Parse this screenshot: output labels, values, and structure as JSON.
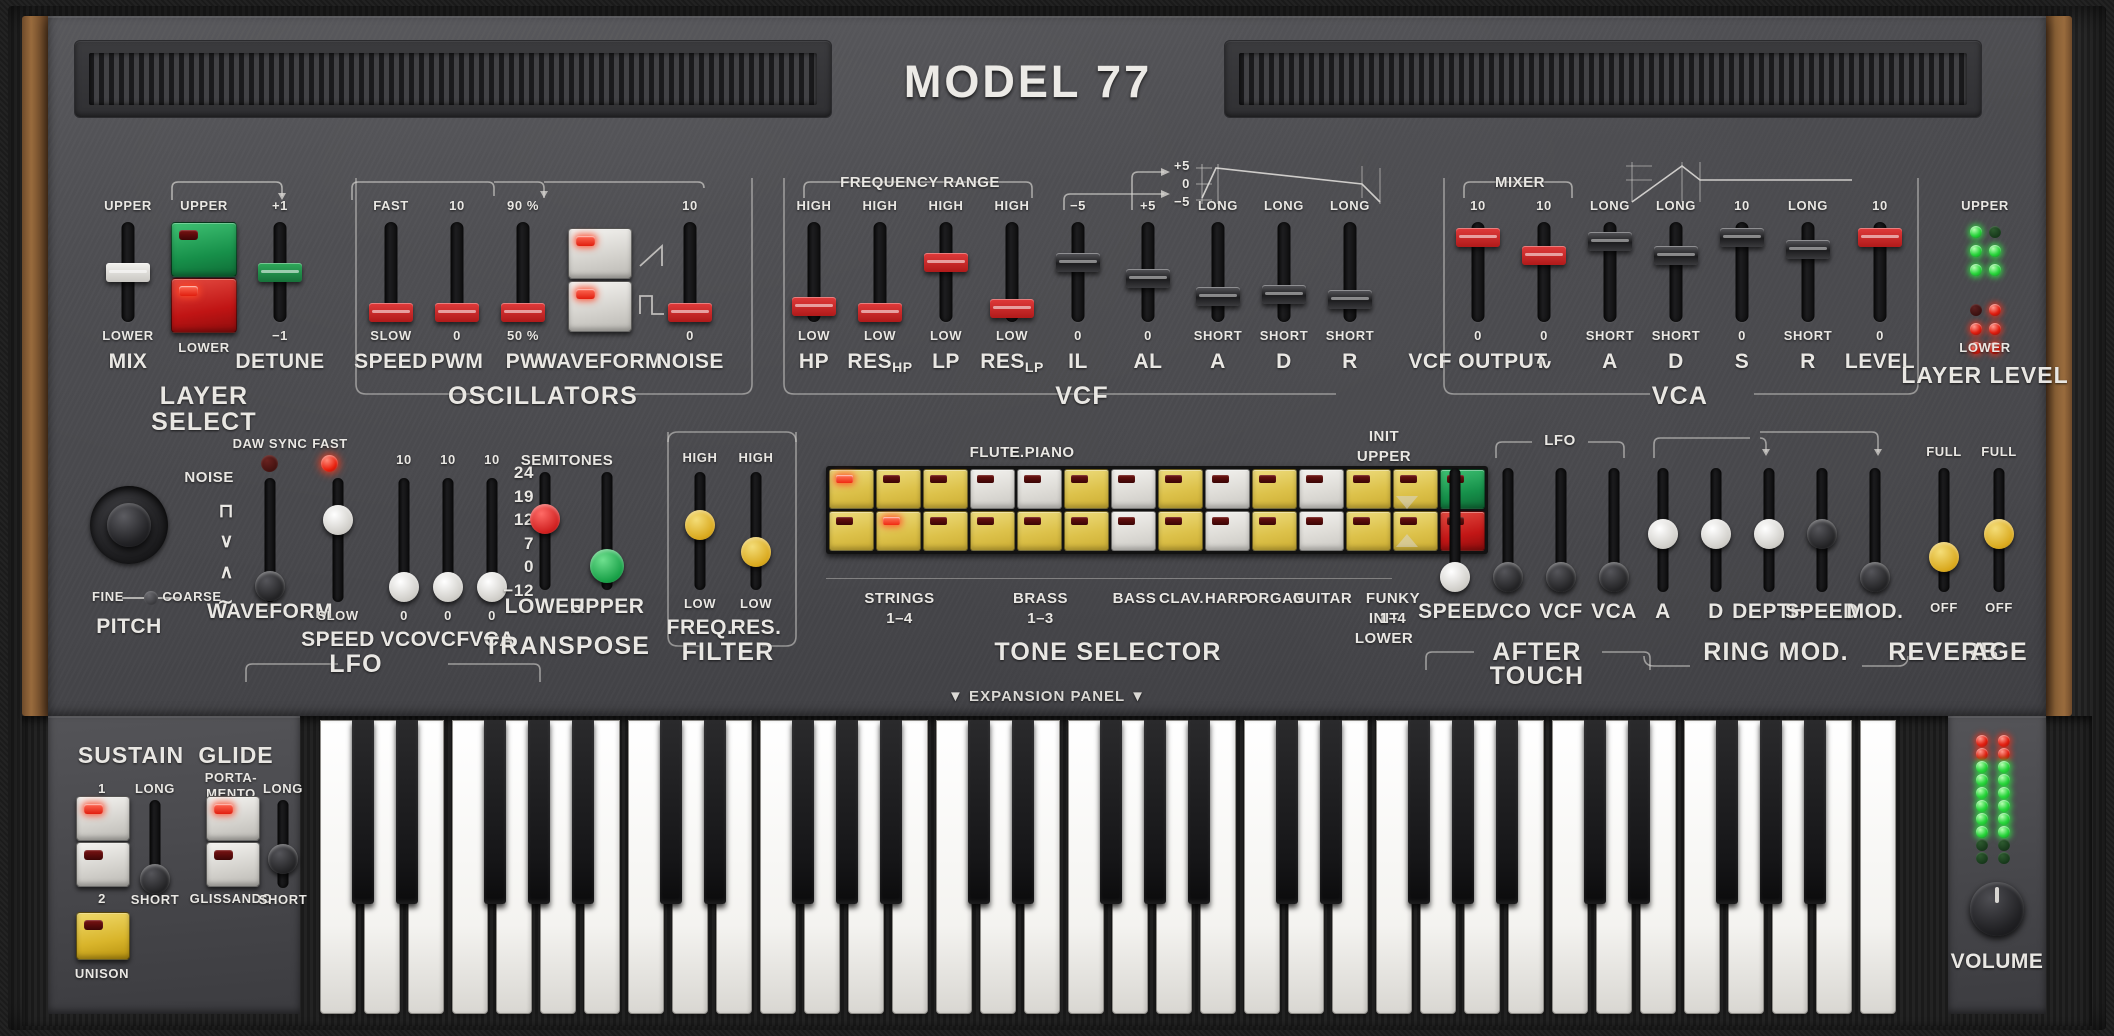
{
  "brand": {
    "title": "MODEL 77"
  },
  "expansion_strip": {
    "label": "▼ EXPANSION PANEL ▼"
  },
  "layer_select": {
    "section": "LAYER SELECT",
    "mix": {
      "param": "MIX",
      "top": "UPPER",
      "bottom": "LOWER"
    },
    "buttons": {
      "upper": "UPPER",
      "lower": "LOWER"
    },
    "detune": {
      "param": "DETUNE",
      "top": "+1",
      "bottom": "−1"
    }
  },
  "oscillators": {
    "section": "OSCILLATORS",
    "speed": {
      "param": "SPEED",
      "top": "FAST",
      "bottom": "SLOW"
    },
    "pwm": {
      "param": "PWM",
      "top": "10",
      "bottom": "0"
    },
    "pw": {
      "param": "PW",
      "top": "90 %",
      "bottom": "50 %"
    },
    "waveform": {
      "param": "WAVEFORM"
    },
    "noise": {
      "param": "NOISE",
      "top": "10",
      "bottom": "0"
    }
  },
  "vcf": {
    "section": "VCF",
    "frequency_range": "FREQUENCY RANGE",
    "hp": {
      "param": "HP",
      "top": "HIGH",
      "bottom": "LOW"
    },
    "reshp": {
      "param": "RES",
      "sub": "HP",
      "top": "HIGH",
      "bottom": "LOW"
    },
    "lp": {
      "param": "LP",
      "top": "HIGH",
      "bottom": "LOW"
    },
    "reslp": {
      "param": "RES",
      "sub": "LP",
      "top": "HIGH",
      "bottom": "LOW"
    },
    "il": {
      "param": "IL",
      "top": "−5",
      "bottom": "0"
    },
    "al": {
      "param": "AL",
      "top": "+5",
      "bottom": "0"
    },
    "a": {
      "param": "A",
      "top": "LONG",
      "bottom": "SHORT"
    },
    "d": {
      "param": "D",
      "top": "LONG",
      "bottom": "SHORT"
    },
    "r": {
      "param": "R",
      "top": "LONG",
      "bottom": "SHORT"
    },
    "env_graph": {
      "plus": "+5",
      "zero": "0",
      "minus": "−5"
    }
  },
  "vca": {
    "section": "VCA",
    "mixer": "MIXER",
    "vcf_output": {
      "param": "VCF OUTPUT",
      "top": "10",
      "bottom": "0"
    },
    "sine": {
      "param": "∿",
      "top": "10",
      "bottom": "0"
    },
    "a": {
      "param": "A",
      "top": "LONG",
      "bottom": "SHORT"
    },
    "d": {
      "param": "D",
      "top": "LONG",
      "bottom": "SHORT"
    },
    "s": {
      "param": "S",
      "top": "10",
      "bottom": "0"
    },
    "r": {
      "param": "R",
      "top": "LONG",
      "bottom": "SHORT"
    },
    "level": {
      "param": "LEVEL",
      "top": "10",
      "bottom": "0"
    }
  },
  "layer_level": {
    "section": "LAYER LEVEL",
    "top": "UPPER",
    "bottom": "LOWER",
    "upper_leds": [
      [
        1,
        0
      ],
      [
        1,
        1
      ],
      [
        1,
        1
      ]
    ],
    "lower_leds": [
      [
        0,
        1
      ],
      [
        1,
        1
      ],
      [
        1,
        1
      ]
    ]
  },
  "pitch": {
    "section": "PITCH",
    "fine": "FINE",
    "coarse": "COARSE"
  },
  "lfo": {
    "section": "LFO",
    "daw_sync": {
      "label": "DAW SYNC",
      "on": false
    },
    "fast_led": {
      "label": "FAST",
      "on": true
    },
    "waveform": {
      "param": "WAVEFORM",
      "scale": [
        "NOISE",
        "⊓",
        "∨",
        "∧",
        "∼"
      ]
    },
    "speed": {
      "param": "SPEED",
      "bottom": "SLOW"
    },
    "vco": {
      "param": "VCO",
      "top": "10",
      "bottom": "0"
    },
    "vcf": {
      "param": "VCF",
      "top": "10",
      "bottom": "0"
    },
    "vca": {
      "param": "VCA",
      "top": "10",
      "bottom": "0"
    }
  },
  "transpose": {
    "section": "TRANSPOSE",
    "semitones": "SEMITONES",
    "scale": [
      "24",
      "19",
      "12",
      "7",
      "0",
      "−12"
    ],
    "lower": "LOWER",
    "upper": "UPPER"
  },
  "filter": {
    "section": "FILTER",
    "freq": {
      "param": "FREQ.",
      "top": "HIGH",
      "bottom": "LOW"
    },
    "res": {
      "param": "RES.",
      "top": "HIGH",
      "bottom": "LOW"
    }
  },
  "tone_selector": {
    "section": "TONE SELECTOR",
    "top_labels": [
      {
        "text": "FLUTE",
        "col": 3
      },
      {
        "text": "E.PIANO",
        "col": 4
      }
    ],
    "bottom_labels": [
      {
        "text": "STRINGS",
        "text2": "1–4",
        "col": 0,
        "span": 3
      },
      {
        "text": "BRASS",
        "text2": "1–3",
        "col": 3,
        "span": 3
      },
      {
        "text": "BASS",
        "col": 6
      },
      {
        "text": "CLAV.",
        "col": 7
      },
      {
        "text": "HARP.",
        "col": 8
      },
      {
        "text": "ORGAN",
        "col": 9
      },
      {
        "text": "GUITAR",
        "col": 10
      },
      {
        "text": "FUNKY",
        "text2": "1–4",
        "col": 11,
        "span": 2
      }
    ],
    "init_upper": "INIT UPPER",
    "init_lower": "INIT LOWER",
    "row_top": [
      "yellow",
      "yellow",
      "yellow",
      "white",
      "white",
      "yellow",
      "white",
      "yellow",
      "white",
      "yellow",
      "white",
      "yellow",
      "yellow"
    ],
    "row_bottom": [
      "yellow",
      "yellow",
      "yellow",
      "yellow",
      "yellow",
      "yellow",
      "white",
      "yellow",
      "white",
      "yellow",
      "white",
      "yellow",
      "yellow"
    ],
    "led_top": [
      1,
      0,
      0,
      0,
      0,
      0,
      0,
      0,
      0,
      0,
      0,
      0,
      0
    ],
    "led_bottom": [
      0,
      1,
      0,
      0,
      0,
      0,
      0,
      0,
      0,
      0,
      0,
      0,
      0
    ],
    "init_upper_btn": "green",
    "init_lower_btn": "red"
  },
  "aftertouch": {
    "section": "AFTER TOUCH",
    "lfo_bracket": "LFO",
    "speed": {
      "param": "SPEED"
    },
    "vco": {
      "param": "VCO"
    },
    "vcf": {
      "param": "VCF"
    },
    "vca": {
      "param": "VCA"
    }
  },
  "ring_mod": {
    "section": "RING MOD.",
    "a": {
      "param": "A"
    },
    "d": {
      "param": "D"
    },
    "depth": {
      "param": "DEPTH"
    },
    "speed": {
      "param": "SPEED"
    },
    "mod": {
      "param": "MOD."
    }
  },
  "reverb": {
    "section": "REVERB",
    "top": "FULL",
    "bottom": "OFF"
  },
  "age": {
    "section": "AGE",
    "top": "FULL",
    "bottom": "OFF"
  },
  "sustain": {
    "section": "SUSTAIN",
    "btn1": "1",
    "btn2": "2",
    "btn1_led": true,
    "btn2_led": false,
    "slider": {
      "top": "LONG",
      "bottom": "SHORT"
    },
    "unison": "UNISON"
  },
  "glide": {
    "section": "GLIDE",
    "portamento": "PORTA-MENTO",
    "portamento_l1": "PORTA-",
    "portamento_l2": "MENTO",
    "glissando": "GLISSANDO",
    "portamento_led": true,
    "glissando_led": false,
    "slider": {
      "top": "LONG",
      "bottom": "SHORT"
    }
  },
  "volume": {
    "label": "VOLUME"
  },
  "level_meter": {
    "left": [
      0,
      0,
      1,
      1,
      1,
      1,
      1,
      1,
      1,
      1
    ],
    "right": [
      0,
      0,
      1,
      1,
      1,
      1,
      1,
      1,
      1,
      1
    ]
  },
  "colors": {
    "panel": "#4b4b4f",
    "accent_red": "#c01414",
    "accent_green": "#17904a",
    "accent_yellow": "#ddc24b",
    "text": "#e9e7e3"
  }
}
